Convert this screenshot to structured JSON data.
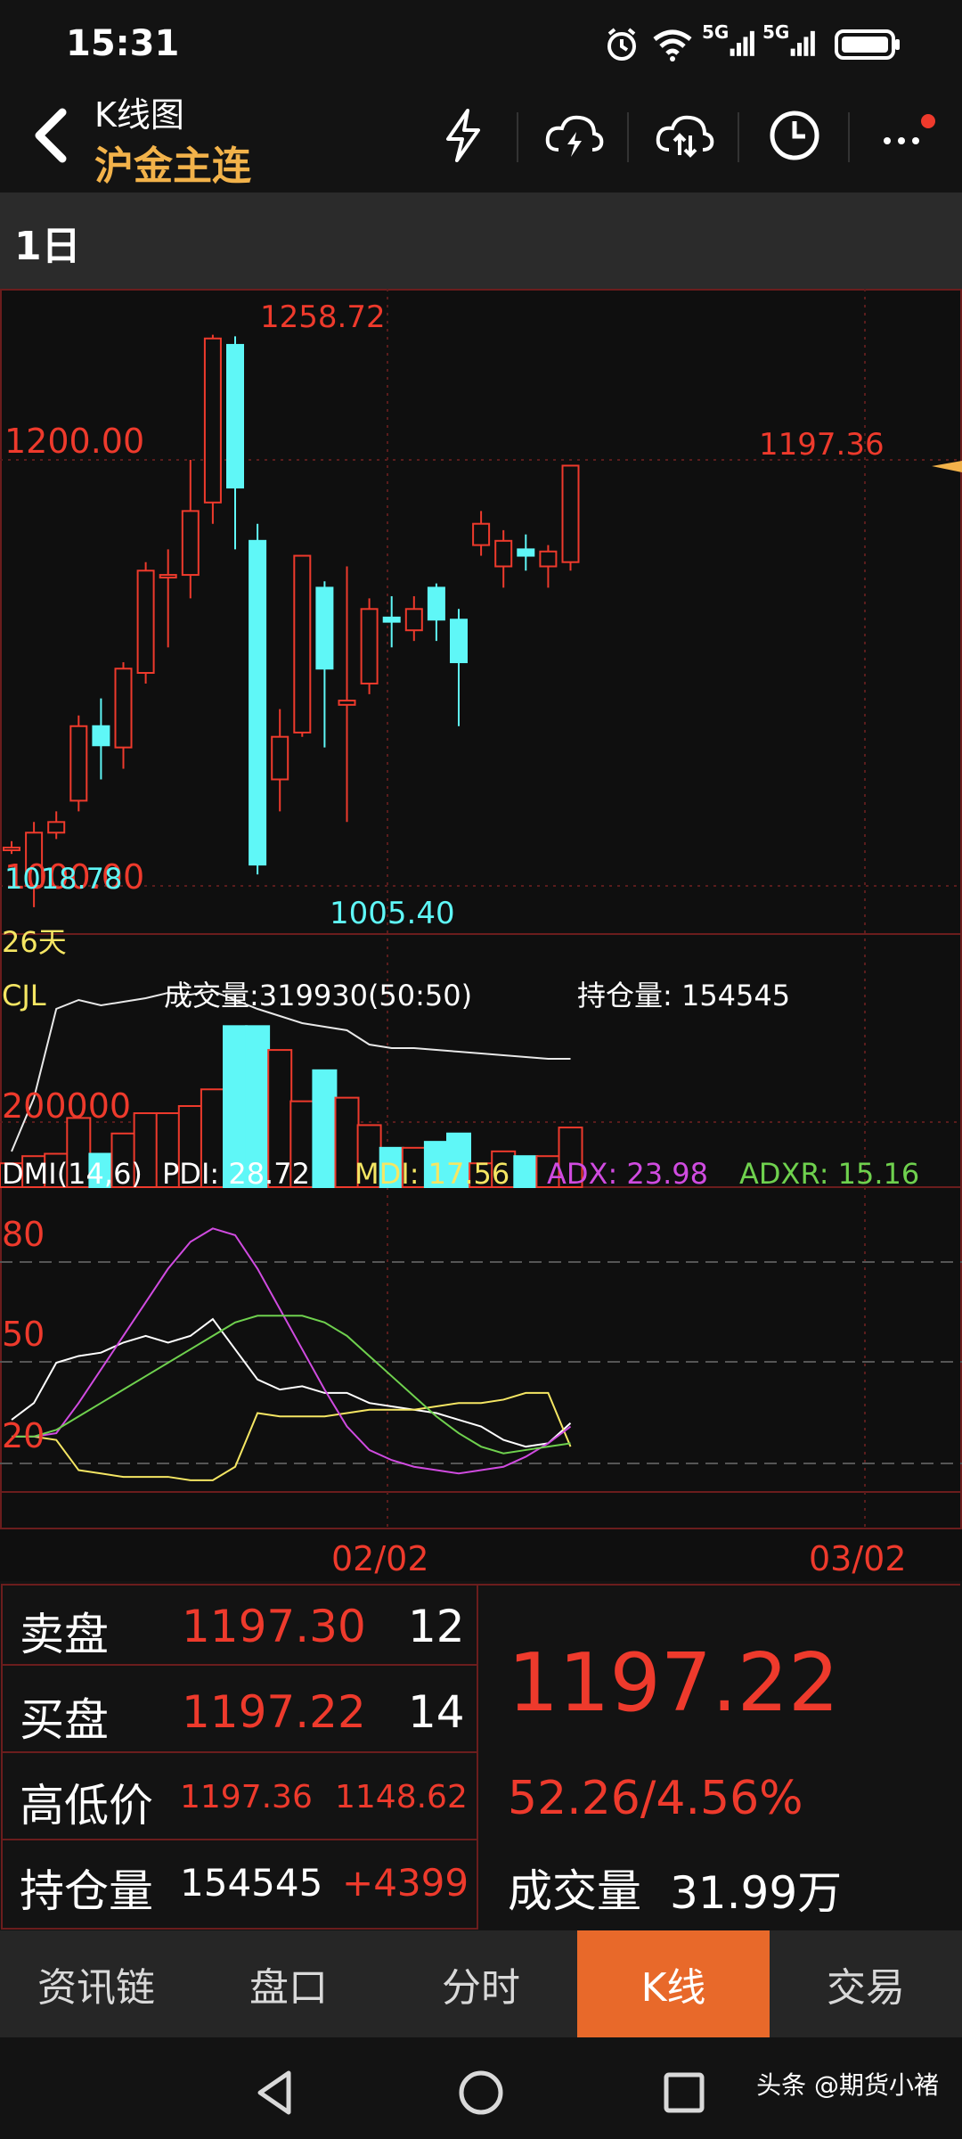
{
  "status": {
    "time": "15:31",
    "net1": "5G",
    "net2": "5G"
  },
  "header": {
    "title": "K线图",
    "subtitle": "沪金主连"
  },
  "period": {
    "label": "1日"
  },
  "chart": {
    "price_labels": {
      "high_point": "1258.72",
      "low_point": "1005.40",
      "last_point": "1197.36",
      "level_upper": "1200.00",
      "level_lower": "1000.00",
      "left_edge": "1018.78"
    },
    "days_label": "26天",
    "volume": {
      "indicator": "CJL",
      "volume_text": "成交量:319930(50:50)",
      "oi_text": "持仓量: 154545",
      "level_label": "200000"
    },
    "dmi": {
      "name": "DMI(14,6)",
      "pdi": "PDI: 28.72",
      "mdi": "MDI: 17.56",
      "adx": "ADX: 23.98",
      "adxr": "ADXR: 15.16",
      "levels": [
        "80",
        "50",
        "20"
      ]
    },
    "dates": [
      "02/02",
      "03/02"
    ],
    "colors": {
      "up": "#ee3a2c",
      "down": "#5ff7f7",
      "pdi": "#ffffff",
      "mdi": "#f5e663",
      "adx": "#d04be0",
      "adxr": "#6fd14e"
    }
  },
  "chart_data": {
    "type": "candlestick",
    "days": 26,
    "ohlc": [
      [
        1018,
        1021,
        1015,
        1018
      ],
      [
        1000,
        1030,
        990,
        1025
      ],
      [
        1025,
        1035,
        1022,
        1030
      ],
      [
        1040,
        1080,
        1035,
        1075
      ],
      [
        1075,
        1088,
        1050,
        1066
      ],
      [
        1065,
        1105,
        1055,
        1102
      ],
      [
        1100,
        1152,
        1095,
        1148
      ],
      [
        1145,
        1158,
        1112,
        1146
      ],
      [
        1146,
        1200,
        1135,
        1176
      ],
      [
        1180,
        1258.72,
        1170,
        1257
      ],
      [
        1254,
        1258,
        1158,
        1187
      ],
      [
        1162,
        1170,
        1005.4,
        1010
      ],
      [
        1050,
        1083,
        1035,
        1070
      ],
      [
        1072,
        1155,
        1070,
        1155
      ],
      [
        1140,
        1143,
        1065,
        1102
      ],
      [
        1085,
        1150,
        1030,
        1087
      ],
      [
        1095,
        1135,
        1090,
        1130
      ],
      [
        1126,
        1136,
        1112,
        1124
      ],
      [
        1120,
        1136,
        1115,
        1130
      ],
      [
        1140,
        1142,
        1115,
        1125
      ],
      [
        1125,
        1130,
        1075,
        1105
      ],
      [
        1160,
        1176,
        1155,
        1170
      ],
      [
        1150,
        1167,
        1140,
        1162
      ],
      [
        1158,
        1165,
        1148,
        1155
      ],
      [
        1150,
        1160,
        1140,
        1157
      ],
      [
        1152,
        1197.36,
        1148,
        1197.3
      ]
    ],
    "volume": [
      0.2,
      0.26,
      0.28,
      0.58,
      0.28,
      0.45,
      0.62,
      0.62,
      0.68,
      0.82,
      1.35,
      1.35,
      1.15,
      0.72,
      0.98,
      0.75,
      0.52,
      0.33,
      0.33,
      0.38,
      0.45,
      0.2,
      0.3,
      0.26,
      0.26,
      0.5
    ],
    "pdi": [
      33,
      38,
      50,
      52,
      53,
      56,
      58,
      56,
      58,
      63,
      54,
      45,
      42,
      43,
      41,
      41,
      38,
      37,
      36,
      35,
      33,
      31,
      27,
      25,
      26,
      32
    ],
    "mdi": [
      28,
      28,
      27,
      18,
      17,
      16,
      16,
      16,
      15,
      15,
      19,
      35,
      34,
      34,
      34,
      35,
      36,
      36,
      36,
      37,
      38,
      38,
      39,
      41,
      41,
      25
    ],
    "adx": [
      28,
      28,
      29,
      38,
      48,
      58,
      68,
      78,
      86,
      90,
      88,
      78,
      66,
      54,
      42,
      31,
      24,
      21,
      19,
      18,
      17,
      18,
      19,
      22,
      26,
      31
    ],
    "adxr": [
      28,
      28,
      30,
      34,
      38,
      42,
      46,
      50,
      54,
      58,
      62,
      64,
      64,
      64,
      62,
      58,
      52,
      46,
      40,
      34,
      29,
      25,
      23,
      24,
      25,
      26
    ]
  },
  "quote": {
    "sell_label": "卖盘",
    "sell_price": "1197.30",
    "sell_vol": "12",
    "buy_label": "买盘",
    "buy_price": "1197.22",
    "buy_vol": "14",
    "hl_label": "高低价",
    "high": "1197.36",
    "low": "1148.62",
    "oi_label": "持仓量",
    "oi_value": "154545",
    "oi_change": "+4399",
    "last_price": "1197.22",
    "change": "52.26/4.56%",
    "vol_label": "成交量",
    "vol_value": "31.99万"
  },
  "tabs": [
    "资讯链",
    "盘口",
    "分时",
    "K线",
    "交易"
  ],
  "watermark": "头条 @期货小褚"
}
